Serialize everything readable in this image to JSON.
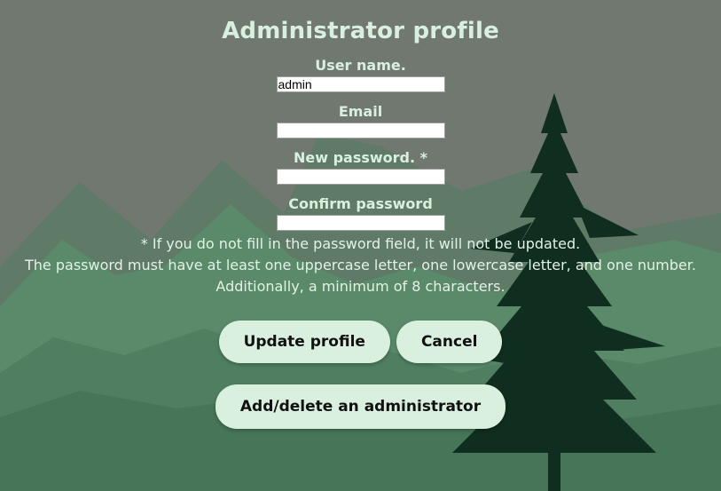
{
  "page": {
    "title": "Administrator profile"
  },
  "form": {
    "username_label": "User name.",
    "username_value": "admin",
    "email_label": "Email",
    "email_value": "",
    "new_password_label": "New password. *",
    "new_password_value": "",
    "confirm_password_label": "Confirm password",
    "confirm_password_value": ""
  },
  "notes": {
    "line1": "* If you do not fill in the password field, it will not be updated.",
    "line2": "The password must have at least one uppercase letter, one lowercase letter, and one number.",
    "line3": "Additionally, a minimum of 8 characters."
  },
  "buttons": {
    "update": "Update profile",
    "cancel": "Cancel",
    "admin": "Add/delete an administrator"
  },
  "colors": {
    "heading": "#d9f0df",
    "button_bg": "#d9f0df",
    "background": "#6f776d",
    "tree": "#0f2e1f"
  },
  "icons": {
    "background": "mountain-pine-landscape"
  }
}
